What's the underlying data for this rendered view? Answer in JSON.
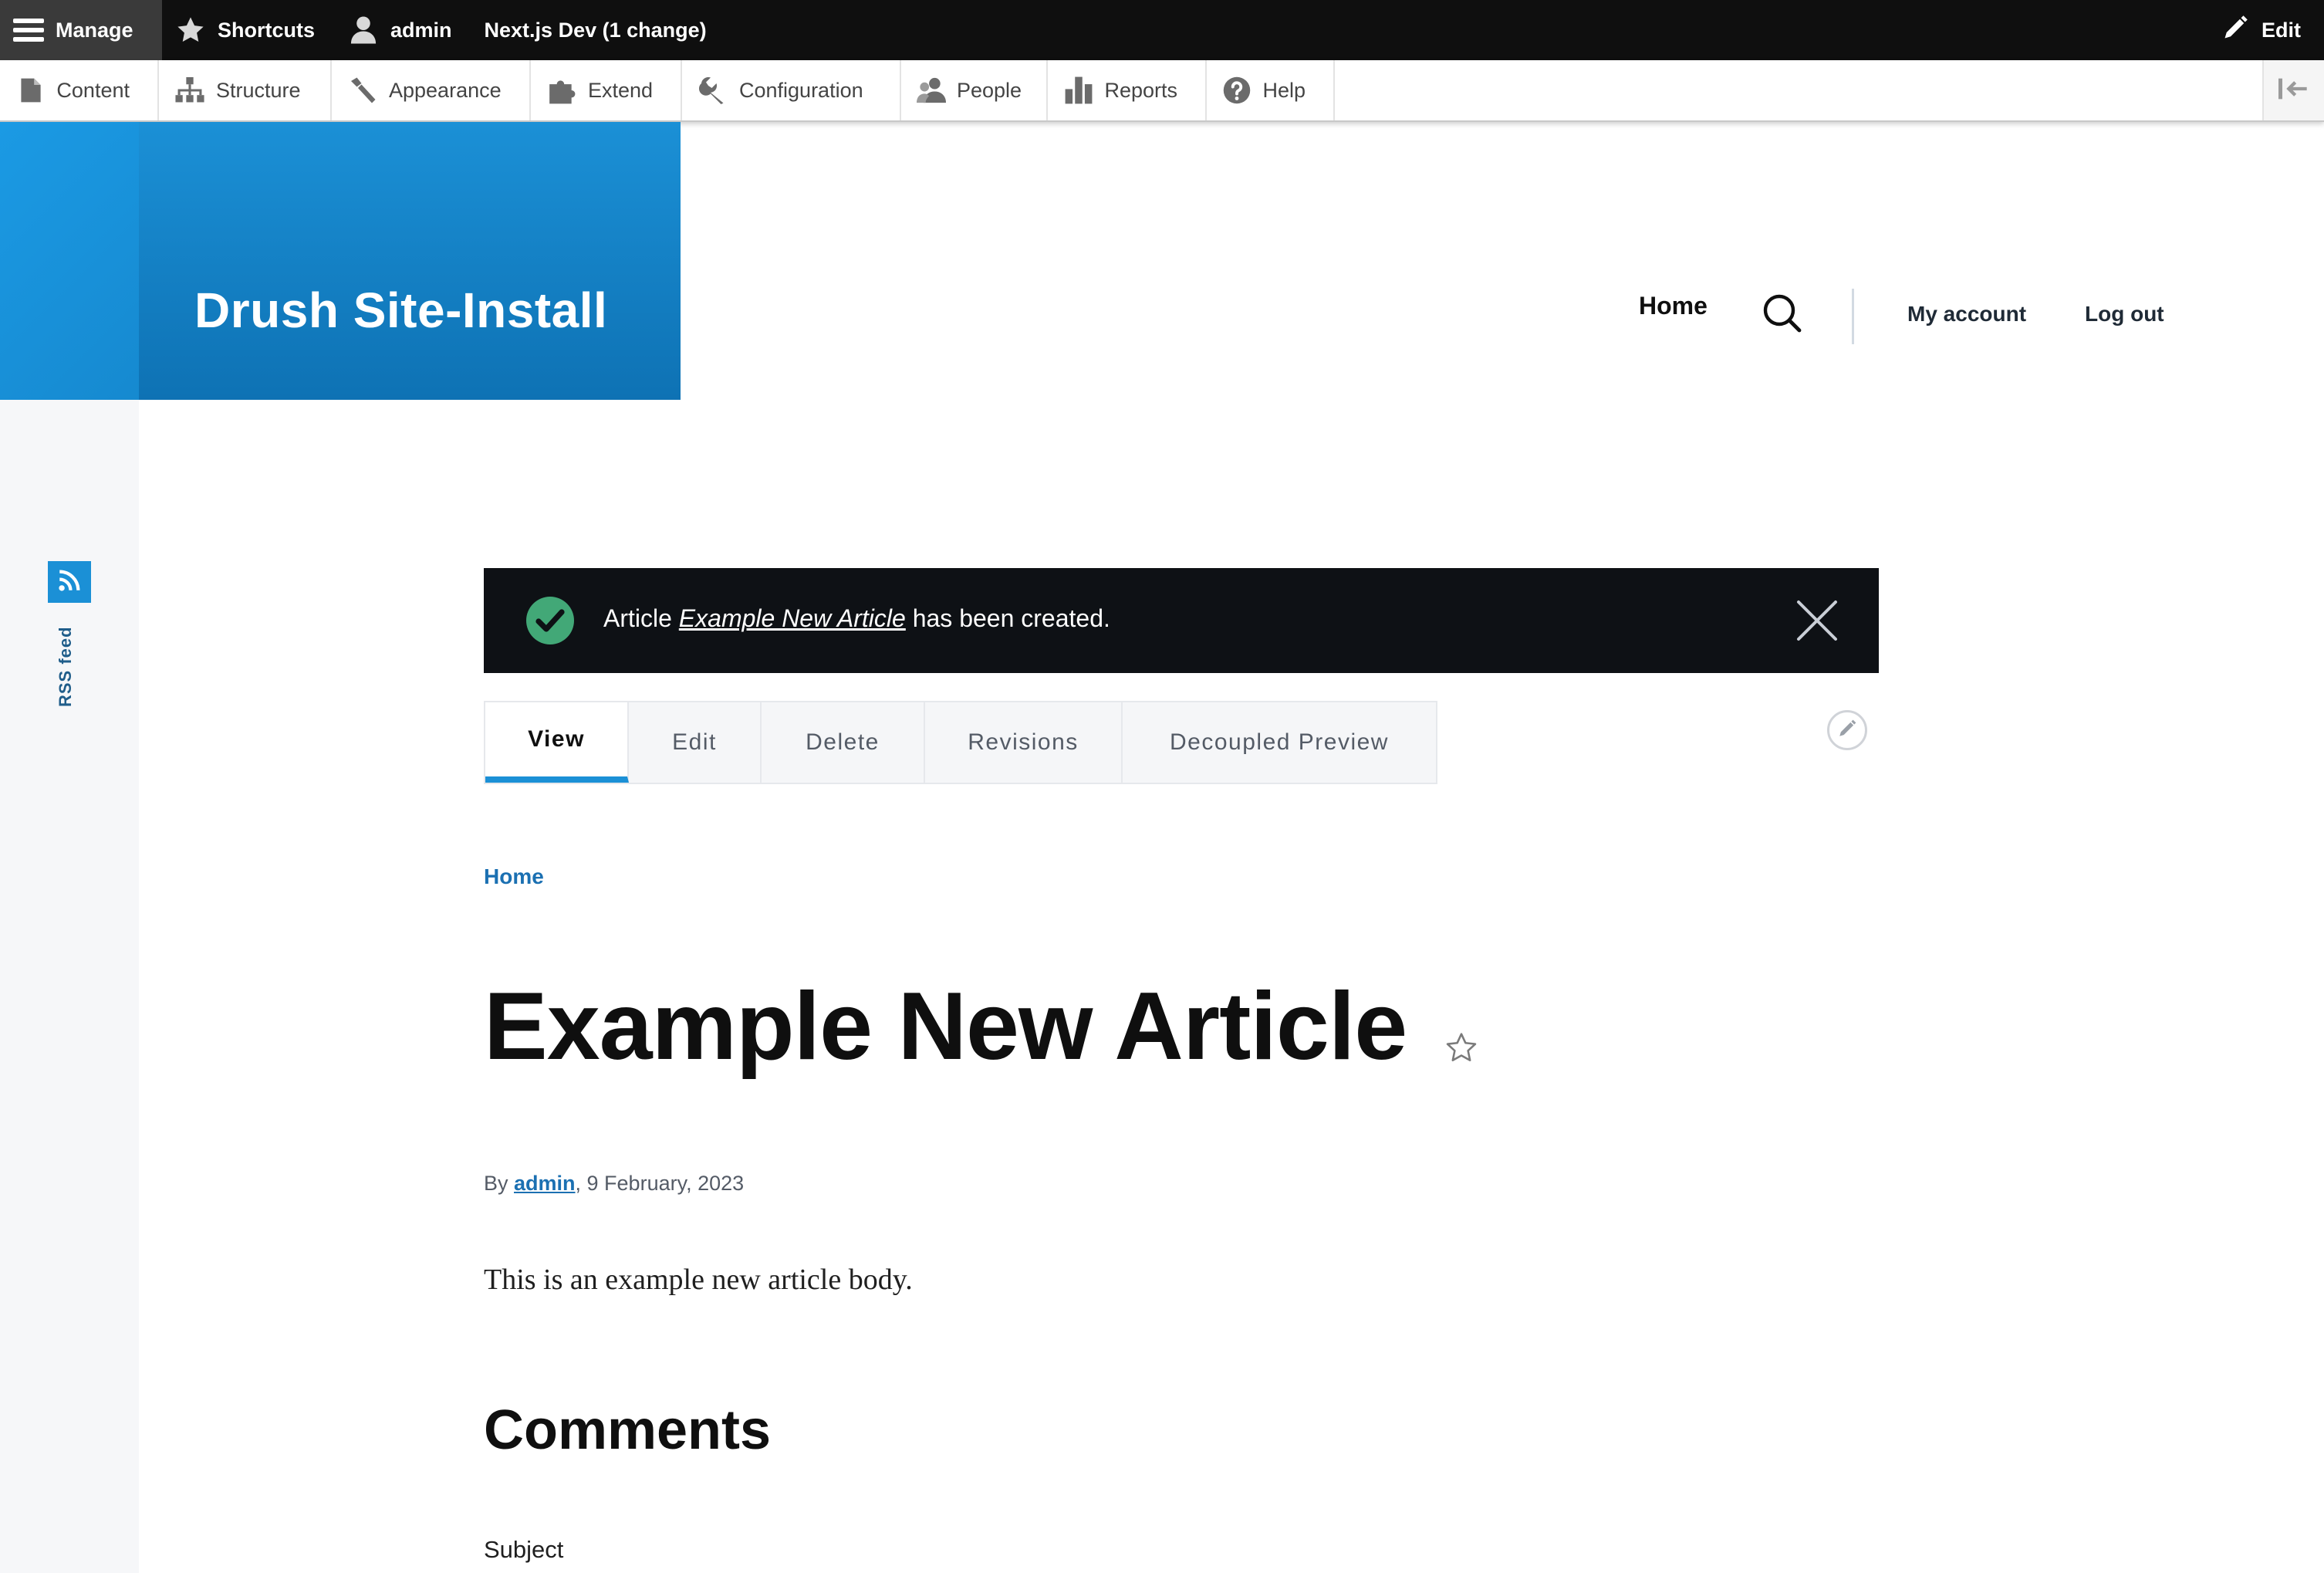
{
  "toolbar": {
    "manage": "Manage",
    "shortcuts": "Shortcuts",
    "user": "admin",
    "workspace": "Next.js Dev (1 change)",
    "edit": "Edit"
  },
  "tray": {
    "items": [
      {
        "label": "Content",
        "icon": "page-icon"
      },
      {
        "label": "Structure",
        "icon": "sitemap-icon"
      },
      {
        "label": "Appearance",
        "icon": "paintbrush-icon"
      },
      {
        "label": "Extend",
        "icon": "puzzle-icon"
      },
      {
        "label": "Configuration",
        "icon": "wrench-icon"
      },
      {
        "label": "People",
        "icon": "people-icon"
      },
      {
        "label": "Reports",
        "icon": "bar-chart-icon"
      },
      {
        "label": "Help",
        "icon": "help-icon"
      }
    ]
  },
  "header": {
    "site_name": "Drush Site-Install",
    "nav_home": "Home",
    "my_account": "My account",
    "log_out": "Log out"
  },
  "sidebar": {
    "rss": "RSS feed"
  },
  "status": {
    "prefix": "Article ",
    "link": "Example New Article",
    "suffix": " has been created."
  },
  "tabs": {
    "view": "View",
    "edit": "Edit",
    "delete": "Delete",
    "revisions": "Revisions",
    "preview": "Decoupled Preview"
  },
  "article": {
    "breadcrumb": "Home",
    "title": "Example New Article",
    "by": "By ",
    "author": "admin",
    "date": ", 9 February, 2023",
    "body": "This is an example new article body.",
    "comments_heading": "Comments",
    "subject_label": "Subject"
  },
  "colors": {
    "brand_blue": "#1b90d6",
    "toolbar_black": "#0f0f0f",
    "status_bg": "#0e1115",
    "success_green": "#42a877",
    "link_blue": "#1b70b2"
  }
}
